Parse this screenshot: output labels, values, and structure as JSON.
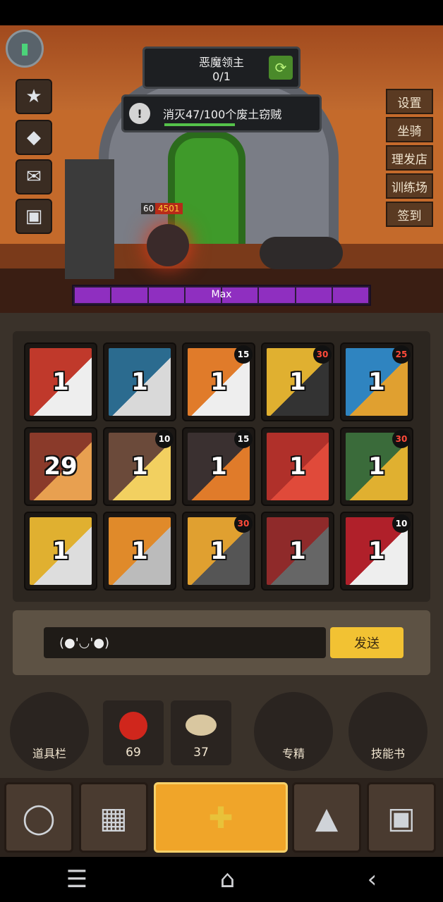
{
  "boss": {
    "title": "恶魔领主",
    "progress": "0/1"
  },
  "quest": {
    "text": "消灭47/100个废土窃贼",
    "progress": 0.47
  },
  "side_menu": [
    "设置",
    "坐骑",
    "理发店",
    "训练场",
    "签到"
  ],
  "player": {
    "level": "60",
    "hp": "4501"
  },
  "xp_bar": {
    "label": "Max"
  },
  "skills": [
    {
      "level": "1",
      "badge": ""
    },
    {
      "level": "1",
      "badge": ""
    },
    {
      "level": "1",
      "badge": "15"
    },
    {
      "level": "1",
      "badge": "30"
    },
    {
      "level": "1",
      "badge": "25"
    },
    {
      "level": "29",
      "badge": ""
    },
    {
      "level": "1",
      "badge": "10"
    },
    {
      "level": "1",
      "badge": "15"
    },
    {
      "level": "1",
      "badge": ""
    },
    {
      "level": "1",
      "badge": "30"
    },
    {
      "level": "1",
      "badge": ""
    },
    {
      "level": "1",
      "badge": ""
    },
    {
      "level": "1",
      "badge": "30"
    },
    {
      "level": "1",
      "badge": ""
    },
    {
      "level": "1",
      "badge": "10"
    }
  ],
  "chat": {
    "input": "(●'◡'●)",
    "send": "发送"
  },
  "bottom": {
    "inventory": "道具栏",
    "potion_count": "69",
    "food_count": "37",
    "mastery": "专精",
    "skill_book": "技能书"
  },
  "colors": {
    "accent": "#f2c233",
    "bar": "#8f2fc0"
  }
}
